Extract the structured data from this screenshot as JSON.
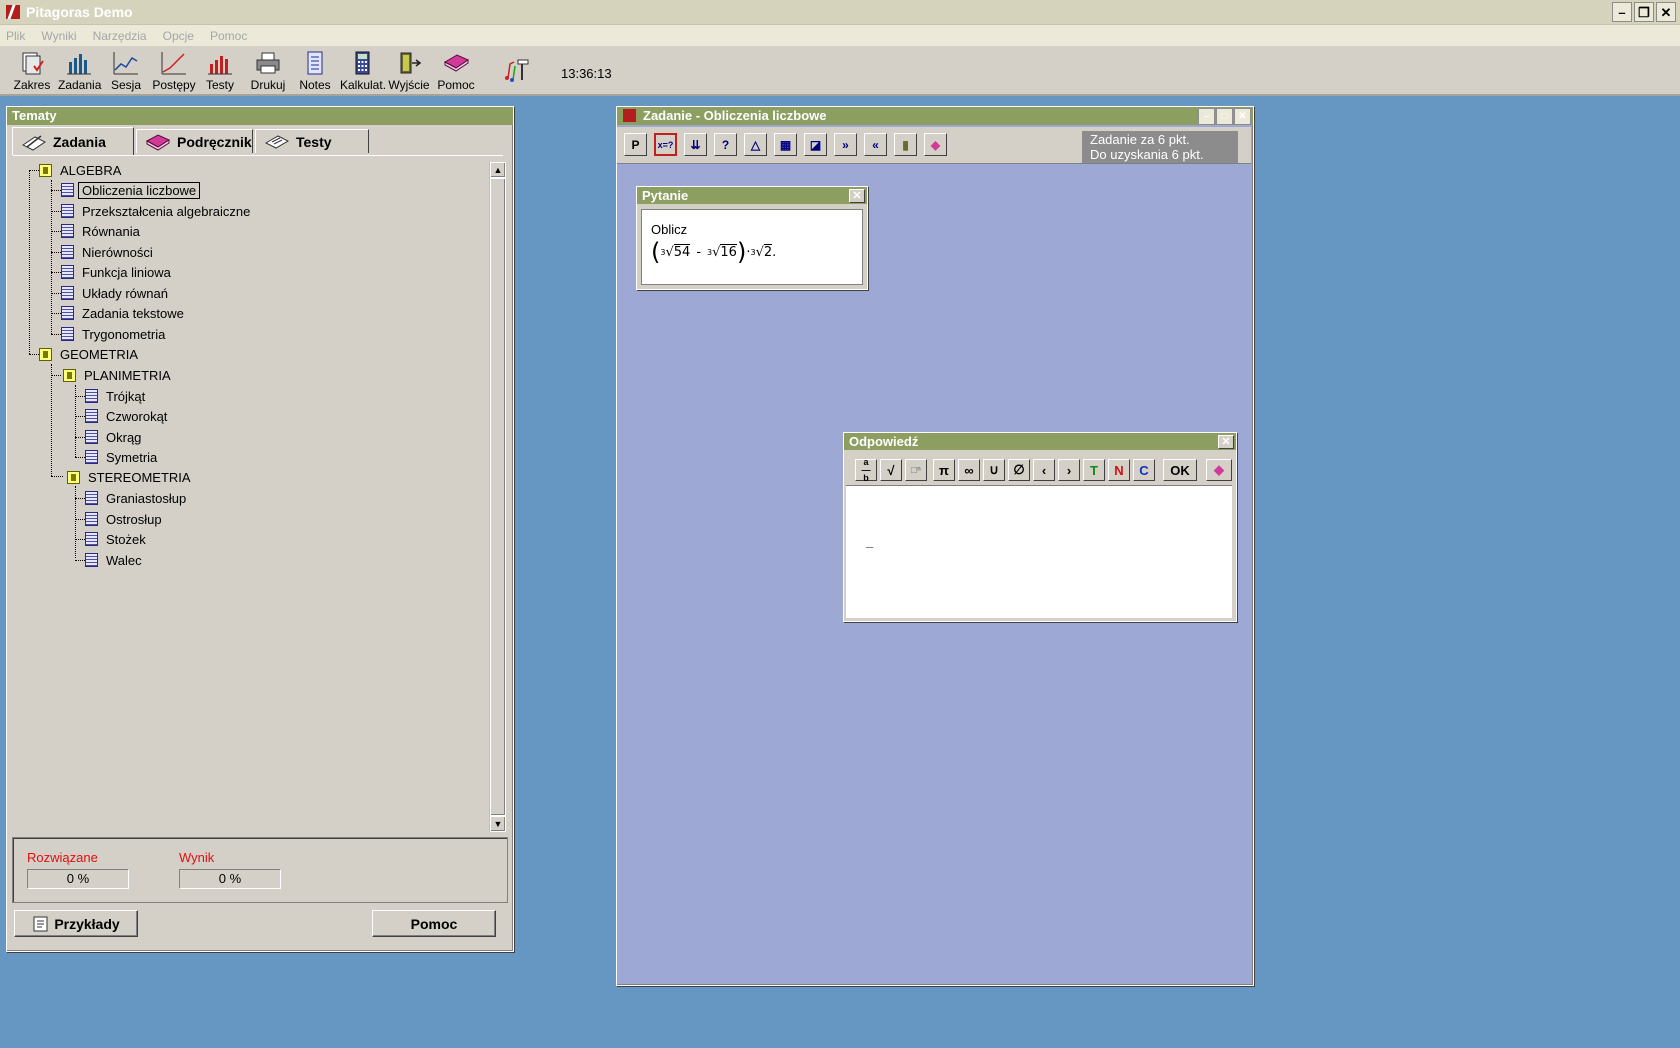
{
  "app": {
    "title": "Pitagoras Demo"
  },
  "menu": [
    "Plik",
    "Wyniki",
    "Narzędzia",
    "Opcje",
    "Pomoc"
  ],
  "toolbar": {
    "items": [
      "Zakres",
      "Zadania",
      "Sesja",
      "Postępy",
      "Testy",
      "Drukuj",
      "Notes",
      "Kalkulat.",
      "Wyjście",
      "Pomoc"
    ],
    "clock": "13:36:13"
  },
  "tematy": {
    "title": "Tematy",
    "tabs": [
      "Zadania",
      "Podręcznik",
      "Testy"
    ],
    "tree": {
      "algebra": "ALGEBRA",
      "algebra_items": [
        "Obliczenia liczbowe",
        "Przekształcenia algebraiczne",
        "Równania",
        "Nierówności",
        "Funkcja liniowa",
        "Układy równań",
        "Zadania tekstowe",
        "Trygonometria"
      ],
      "geometria": "GEOMETRIA",
      "planimetria": "PLANIMETRIA",
      "planimetria_items": [
        "Trójkąt",
        "Czworokąt",
        "Okrąg",
        "Symetria"
      ],
      "stereometria": "STEREOMETRIA",
      "stereometria_items": [
        "Graniastosłup",
        "Ostrosłup",
        "Stożek",
        "Walec"
      ]
    },
    "stats": {
      "solved_label": "Rozwiązane",
      "solved_value": "0 %",
      "score_label": "Wynik",
      "score_value": "0 %"
    },
    "examples_button": "Przykłady",
    "help_button": "Pomoc"
  },
  "zadanie": {
    "title": "Zadanie - Obliczenia liczbowe",
    "tools": [
      "P",
      "x=?",
      "?"
    ],
    "points_line1": "Zadanie za 6 pkt.",
    "points_line2": "Do uzyskania 6 pkt."
  },
  "pytanie": {
    "title": "Pytanie",
    "prompt": "Oblicz",
    "expr": {
      "idx": "3",
      "r1": "54",
      "minus": "-",
      "r2": "16",
      "r3": "2",
      "dot": "."
    }
  },
  "odpowiedz": {
    "title": "Odpowiedź",
    "tools": [
      "π",
      "∞",
      "∪",
      "∅",
      "T",
      "N",
      "C",
      "OK"
    ],
    "cursor": "_"
  },
  "colors": {
    "desktop": "#6696c2",
    "panel_title": "#8c9e60",
    "workspace": "#9ea8d4",
    "stat_label": "#e01010"
  }
}
